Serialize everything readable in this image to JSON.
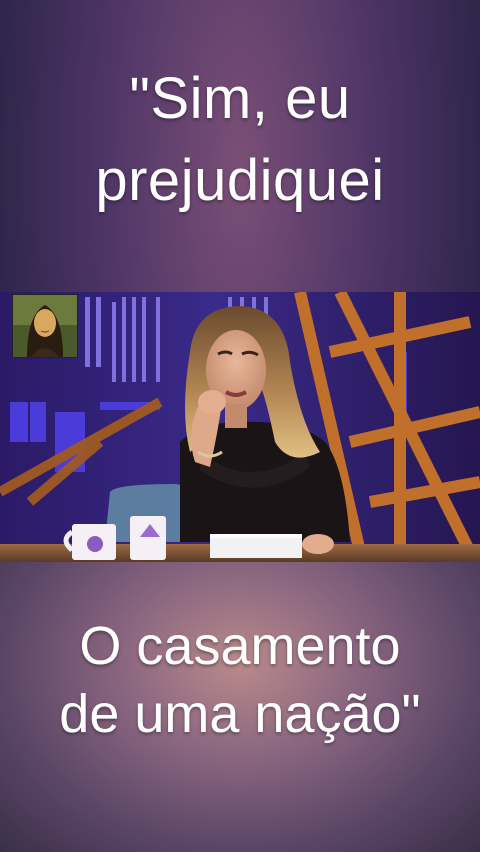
{
  "caption": {
    "top_line1": "\"Sim, eu",
    "top_line2": "prejudiquei",
    "bottom_line1": "O casamento",
    "bottom_line2": "de uma nação\""
  },
  "thumbnail": {
    "icon": "mona-lisa-avatar"
  },
  "video": {
    "scene": "tv-studio-host-at-desk"
  }
}
